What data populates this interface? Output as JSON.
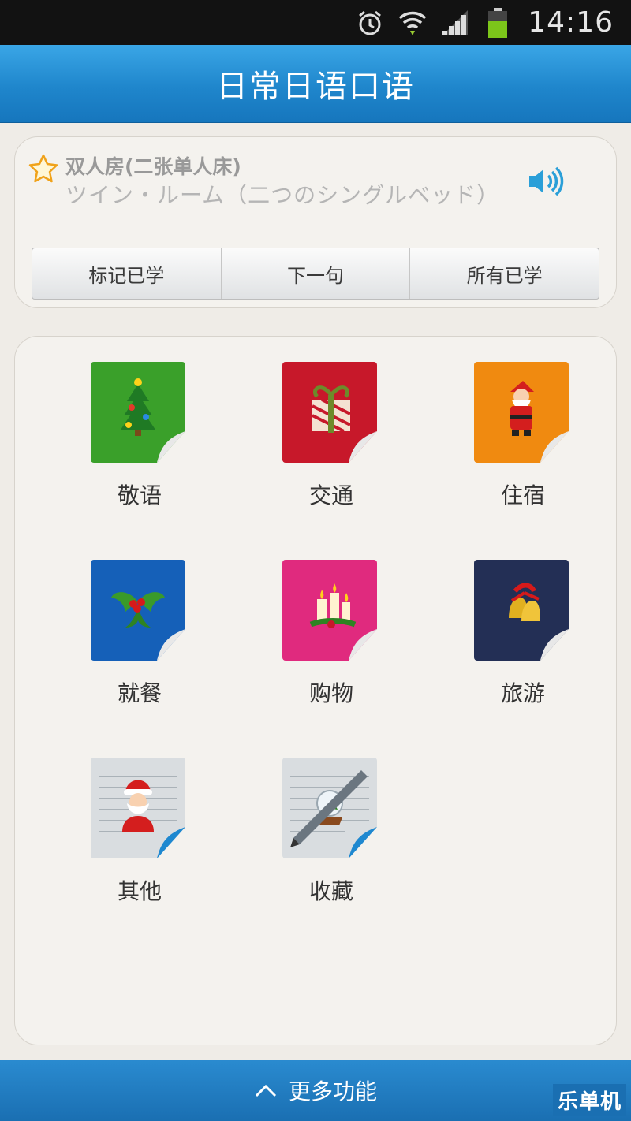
{
  "status_bar": {
    "time": "14:16"
  },
  "title": "日常日语口语",
  "phrase_card": {
    "chinese": "双人房(二张单人床)",
    "japanese": "ツイン・ルーム（二つのシングルベッド）",
    "buttons": [
      "标记已学",
      "下一句",
      "所有已学"
    ]
  },
  "categories": [
    {
      "label": "敬语",
      "color": "#3aa02a",
      "icon": "christmas-tree-icon"
    },
    {
      "label": "交通",
      "color": "#c7182a",
      "icon": "gift-box-icon"
    },
    {
      "label": "住宿",
      "color": "#f08a10",
      "icon": "santa-claus-icon"
    },
    {
      "label": "就餐",
      "color": "#1560b8",
      "icon": "holly-icon"
    },
    {
      "label": "购物",
      "color": "#e02a7e",
      "icon": "candles-icon"
    },
    {
      "label": "旅游",
      "color": "#232f55",
      "icon": "bells-icon"
    },
    {
      "label": "其他",
      "color": "#d9dde0",
      "icon": "santa-notepad-icon"
    },
    {
      "label": "收藏",
      "color": "#d9dde0",
      "icon": "pen-notepad-icon"
    }
  ],
  "bottom_bar": {
    "label": "更多功能"
  },
  "watermark": "乐单机",
  "colors": {
    "accent": "#1f86cc",
    "background": "#efece7"
  }
}
